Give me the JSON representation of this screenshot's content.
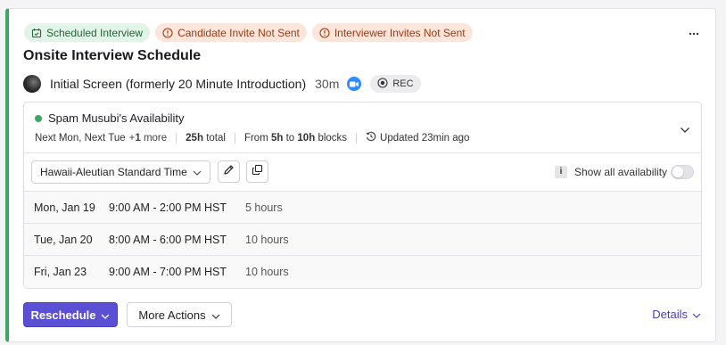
{
  "badges": {
    "scheduled": "Scheduled Interview",
    "candidate": "Candidate Invite Not Sent",
    "interviewer": "Interviewer Invites Not Sent"
  },
  "title": "Onsite Interview Schedule",
  "interview": {
    "name": "Initial Screen (formerly 20 Minute Introduction)",
    "duration": "30m",
    "rec_label": "REC"
  },
  "availability": {
    "name": "Spam Musubi's Availability",
    "days": "Next Mon, Next Tue",
    "more_prefix": "+",
    "more_count": "1",
    "more_suffix": "more",
    "total_value": "25h",
    "total_suffix": "total",
    "from_label": "From",
    "from_value": "5h",
    "to_label": "to",
    "to_value": "10h",
    "blocks_label": "blocks",
    "updated": "Updated 23min ago"
  },
  "timezone": {
    "selected": "Hawaii-Aleutian Standard Time",
    "show_all_label": "Show all availability",
    "info_glyph": "i",
    "show_all_enabled": false
  },
  "slots": [
    {
      "day": "Mon, Jan 19",
      "time": "9:00 AM - 2:00 PM HST",
      "hours": "5 hours"
    },
    {
      "day": "Tue, Jan 20",
      "time": "8:00 AM - 6:00 PM HST",
      "hours": "10 hours"
    },
    {
      "day": "Fri, Jan 23",
      "time": "9:00 AM - 7:00 PM HST",
      "hours": "10 hours"
    }
  ],
  "actions": {
    "reschedule": "Reschedule",
    "more_actions": "More Actions",
    "details": "Details"
  },
  "colors": {
    "accent_bar": "#3aa860",
    "primary_button": "#5b4fd4",
    "link": "#4a42b8",
    "badge_green_bg": "#e2f3e7",
    "badge_orange_bg": "#fce5da"
  },
  "icons": {
    "scheduled": "calendar-check-icon",
    "warning": "alert-circle-icon",
    "menu": "kebab-menu-icon",
    "video": "zoom-video-icon",
    "record": "record-icon",
    "history": "history-clock-icon",
    "edit": "pencil-icon",
    "copy": "copy-icon",
    "expand": "chevron-down-icon"
  }
}
